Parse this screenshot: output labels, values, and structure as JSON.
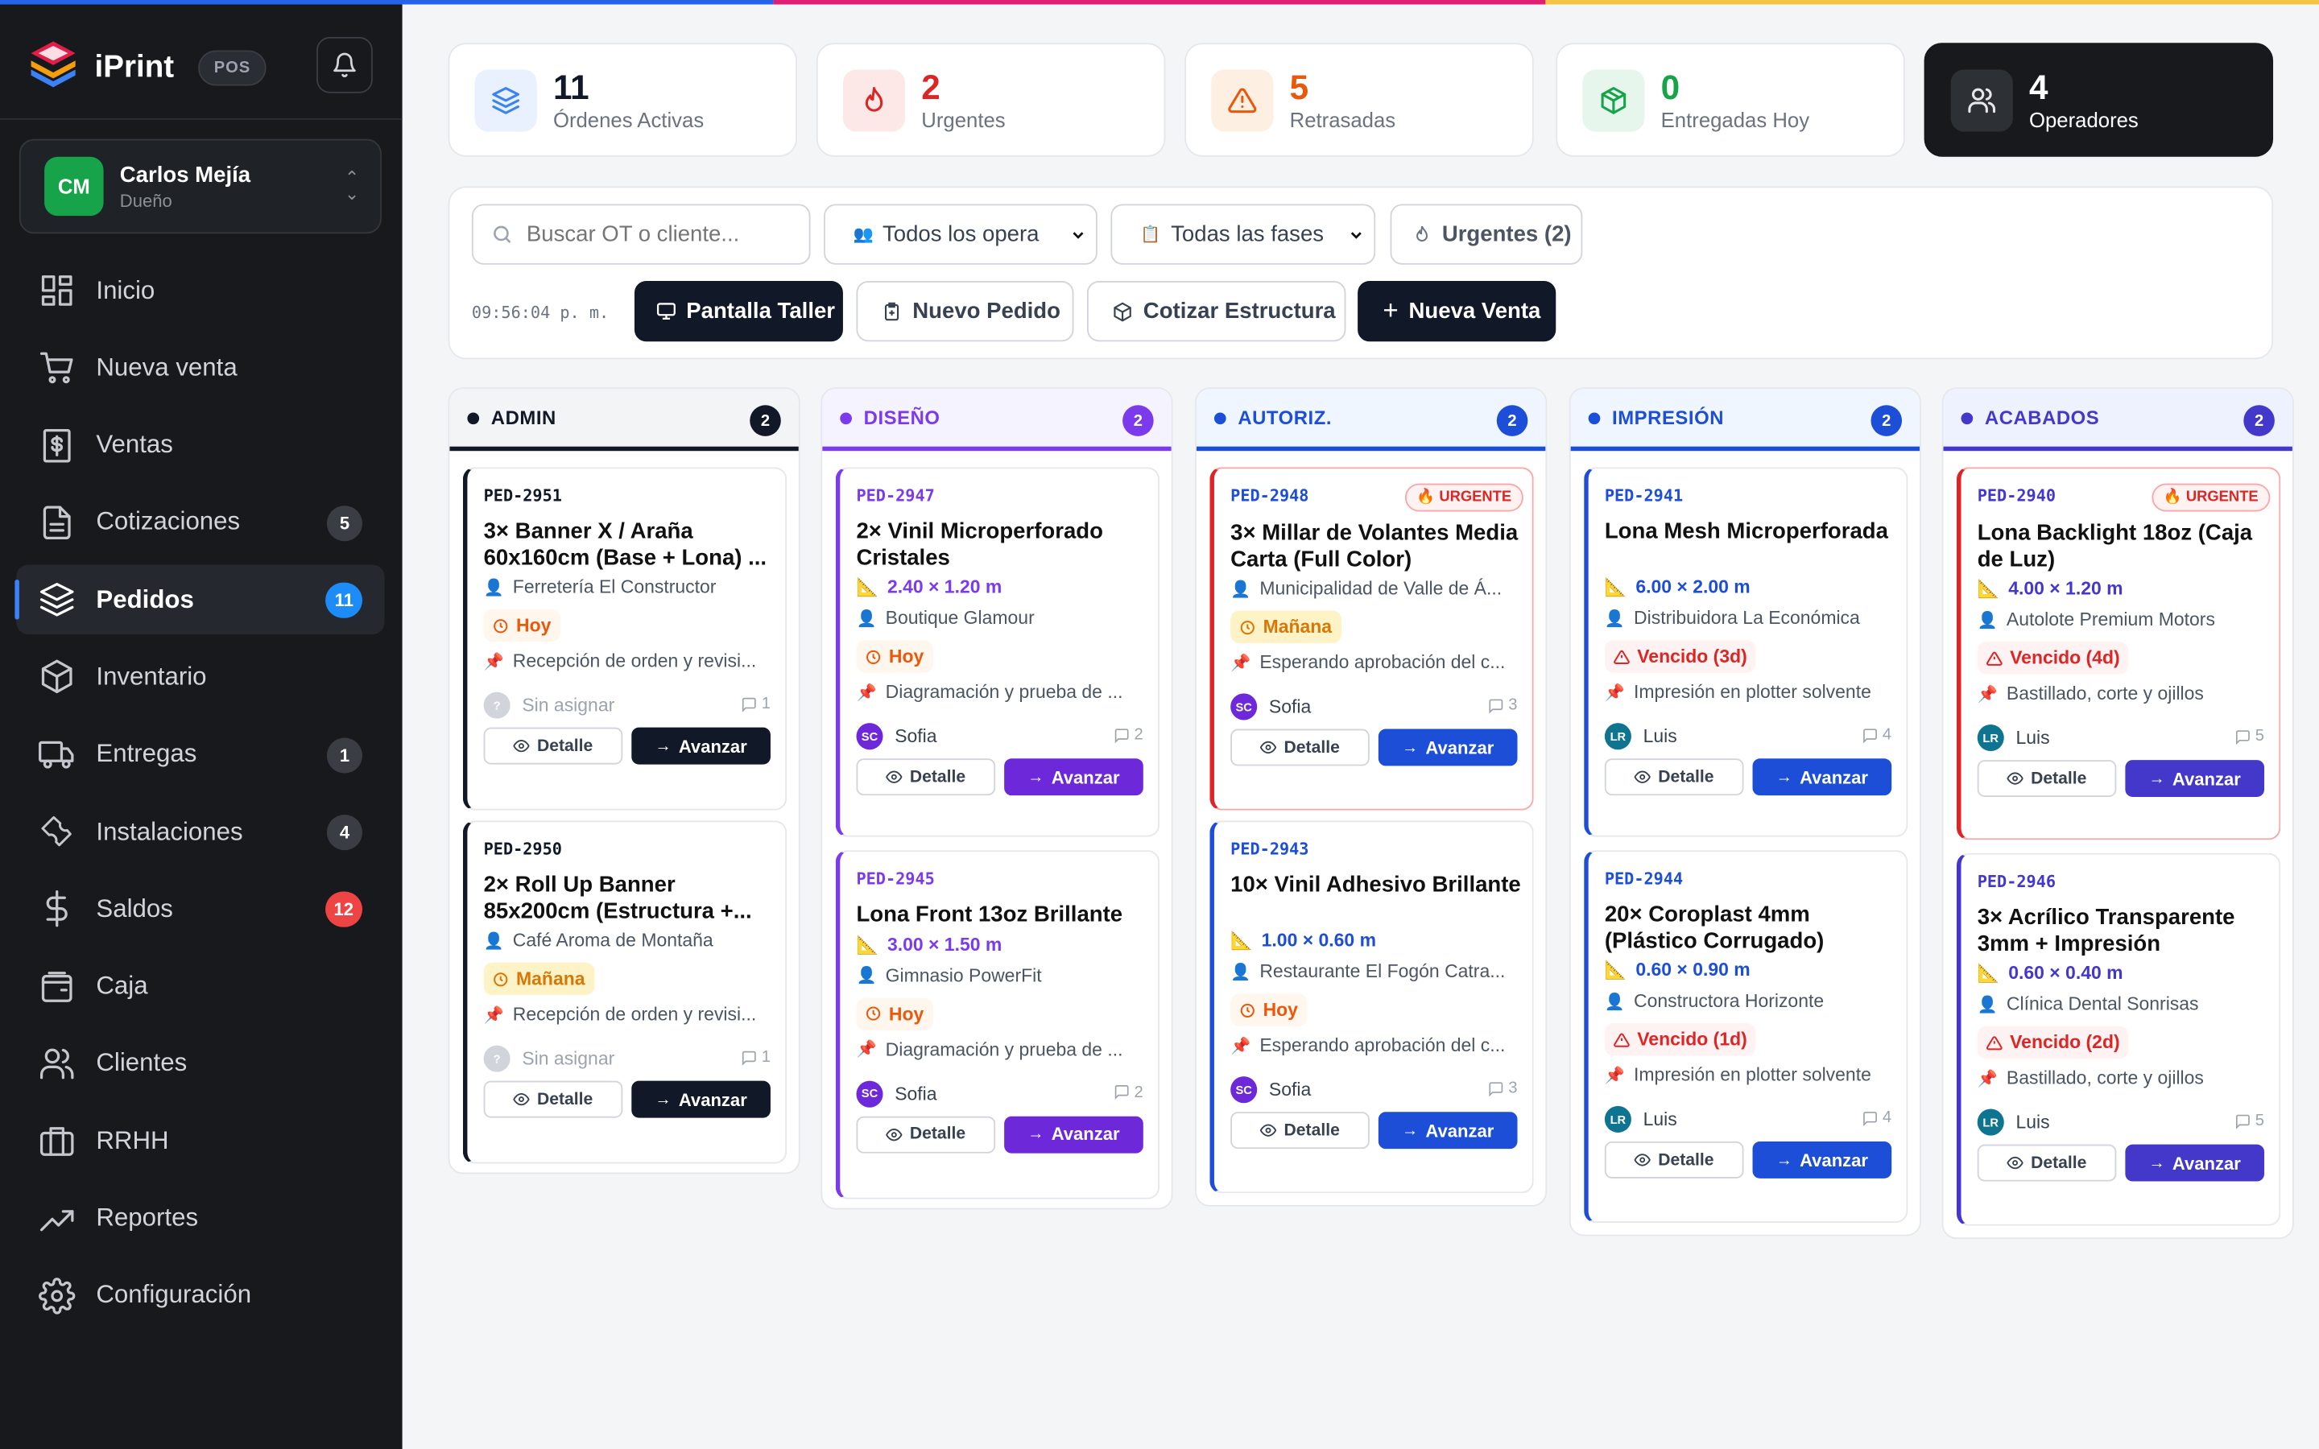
{
  "colors": {
    "sidebar_bg": "#17191d",
    "accent_blue": "#3b82f6",
    "admin": "#111827",
    "diseno": "#7c3aed",
    "autoriz": "#1d4ed8",
    "impresion": "#1d4ed8",
    "acabados": "#4338ca",
    "urgent": "#dc2626"
  },
  "app": {
    "name": "iPrint",
    "badge": "POS"
  },
  "user": {
    "initials": "CM",
    "name": "Carlos Mejía",
    "role": "Dueño"
  },
  "nav": [
    {
      "label": "Inicio",
      "icon": "dashboard-icon",
      "badge": ""
    },
    {
      "label": "Nueva venta",
      "icon": "cart-icon",
      "badge": ""
    },
    {
      "label": "Ventas",
      "icon": "receipt-icon",
      "badge": ""
    },
    {
      "label": "Cotizaciones",
      "icon": "document-icon",
      "badge": "5"
    },
    {
      "label": "Pedidos",
      "icon": "layers-icon",
      "badge": "11"
    },
    {
      "label": "Inventario",
      "icon": "box-icon",
      "badge": ""
    },
    {
      "label": "Entregas",
      "icon": "truck-icon",
      "badge": "1"
    },
    {
      "label": "Instalaciones",
      "icon": "wrench-icon",
      "badge": "4"
    },
    {
      "label": "Saldos",
      "icon": "dollar-icon",
      "badge": "12"
    },
    {
      "label": "Caja",
      "icon": "wallet-icon",
      "badge": ""
    },
    {
      "label": "Clientes",
      "icon": "users-icon",
      "badge": ""
    },
    {
      "label": "RRHH",
      "icon": "briefcase-icon",
      "badge": ""
    },
    {
      "label": "Reportes",
      "icon": "trending-icon",
      "badge": ""
    },
    {
      "label": "Configuración",
      "icon": "settings-icon",
      "badge": ""
    }
  ],
  "stats": [
    {
      "value": "11",
      "label": "Órdenes Activas",
      "icon": "layers-icon"
    },
    {
      "value": "2",
      "label": "Urgentes",
      "icon": "flame-icon"
    },
    {
      "value": "5",
      "label": "Retrasadas",
      "icon": "warning-icon"
    },
    {
      "value": "0",
      "label": "Entregadas Hoy",
      "icon": "package-icon"
    },
    {
      "value": "4",
      "label": "Operadores",
      "icon": "users-icon"
    }
  ],
  "toolbar": {
    "search_placeholder": "Buscar OT o cliente...",
    "operator_filter": "Todos los opera",
    "phase_filter": "Todas las fases",
    "urgent_filter": "Urgentes (2)",
    "clock": "09:56:04 p. m.",
    "shop_screen": "Pantalla Taller",
    "new_order": "Nuevo Pedido",
    "quote_structure": "Cotizar Estructura",
    "new_sale": "Nueva Venta"
  },
  "columns": [
    {
      "title": "ADMIN",
      "count": "2",
      "cards": [
        {
          "code": "PED-2951",
          "urgent": "",
          "title": "3× Banner X / Araña 60x160cm (Base + Lona) ...",
          "dims": "",
          "client": "Ferretería El Constructor",
          "date": "Hoy",
          "task": "Recepción de orden y revisi...",
          "assignee_initials": "?",
          "assignee": "Sin asignar",
          "comments": "1",
          "detail": "Detalle",
          "advance": "Avanzar"
        },
        {
          "code": "PED-2950",
          "urgent": "",
          "title": "2× Roll Up Banner 85x200cm (Estructura +...",
          "dims": "",
          "client": "Café Aroma de Montaña",
          "date": "Mañana",
          "task": "Recepción de orden y revisi...",
          "assignee_initials": "?",
          "assignee": "Sin asignar",
          "comments": "1",
          "detail": "Detalle",
          "advance": "Avanzar"
        }
      ]
    },
    {
      "title": "DISEÑO",
      "count": "2",
      "cards": [
        {
          "code": "PED-2947",
          "urgent": "",
          "title": "2× Vinil Microperforado Cristales",
          "dims": "2.40 × 1.20 m",
          "client": "Boutique Glamour",
          "date": "Hoy",
          "task": "Diagramación y prueba de ...",
          "assignee_initials": "SC",
          "assignee": "Sofia",
          "comments": "2",
          "detail": "Detalle",
          "advance": "Avanzar"
        },
        {
          "code": "PED-2945",
          "urgent": "",
          "title": "Lona Front 13oz Brillante",
          "dims": "3.00 × 1.50 m",
          "client": "Gimnasio PowerFit",
          "date": "Hoy",
          "task": "Diagramación y prueba de ...",
          "assignee_initials": "SC",
          "assignee": "Sofia",
          "comments": "2",
          "detail": "Detalle",
          "advance": "Avanzar"
        }
      ]
    },
    {
      "title": "AUTORIZ.",
      "count": "2",
      "cards": [
        {
          "code": "PED-2948",
          "urgent": "URGENTE",
          "title": "3× Millar de Volantes Media Carta (Full Color)",
          "dims": "",
          "client": "Municipalidad de Valle de Á...",
          "date": "Mañana",
          "task": "Esperando aprobación del c...",
          "assignee_initials": "SC",
          "assignee": "Sofia",
          "comments": "3",
          "detail": "Detalle",
          "advance": "Avanzar"
        },
        {
          "code": "PED-2943",
          "urgent": "",
          "title": "10× Vinil Adhesivo Brillante",
          "dims": "1.00 × 0.60 m",
          "client": "Restaurante El Fogón Catra...",
          "date": "Hoy",
          "task": "Esperando aprobación del c...",
          "assignee_initials": "SC",
          "assignee": "Sofia",
          "comments": "3",
          "detail": "Detalle",
          "advance": "Avanzar"
        }
      ]
    },
    {
      "title": "IMPRESIÓN",
      "count": "2",
      "cards": [
        {
          "code": "PED-2941",
          "urgent": "",
          "title": "Lona Mesh Microperforada",
          "dims": "6.00 × 2.00 m",
          "client": "Distribuidora La Económica",
          "date": "Vencido (3d)",
          "task": "Impresión en plotter solvente",
          "assignee_initials": "LR",
          "assignee": "Luis",
          "comments": "4",
          "detail": "Detalle",
          "advance": "Avanzar"
        },
        {
          "code": "PED-2944",
          "urgent": "",
          "title": "20× Coroplast 4mm (Plástico Corrugado)",
          "dims": "0.60 × 0.90 m",
          "client": "Constructora Horizonte",
          "date": "Vencido (1d)",
          "task": "Impresión en plotter solvente",
          "assignee_initials": "LR",
          "assignee": "Luis",
          "comments": "4",
          "detail": "Detalle",
          "advance": "Avanzar"
        }
      ]
    },
    {
      "title": "ACABADOS",
      "count": "2",
      "cards": [
        {
          "code": "PED-2940",
          "urgent": "URGENTE",
          "title": "Lona Backlight 18oz (Caja de Luz)",
          "dims": "4.00 × 1.20 m",
          "client": "Autolote Premium Motors",
          "date": "Vencido (4d)",
          "task": "Bastillado, corte y ojillos",
          "assignee_initials": "LR",
          "assignee": "Luis",
          "comments": "5",
          "detail": "Detalle",
          "advance": "Avanzar"
        },
        {
          "code": "PED-2946",
          "urgent": "",
          "title": "3× Acrílico Transparente 3mm + Impresión",
          "dims": "0.60 × 0.40 m",
          "client": "Clínica Dental Sonrisas",
          "date": "Vencido (2d)",
          "task": "Bastillado, corte y ojillos",
          "assignee_initials": "LR",
          "assignee": "Luis",
          "comments": "5",
          "detail": "Detalle",
          "advance": "Avanzar"
        }
      ]
    }
  ]
}
